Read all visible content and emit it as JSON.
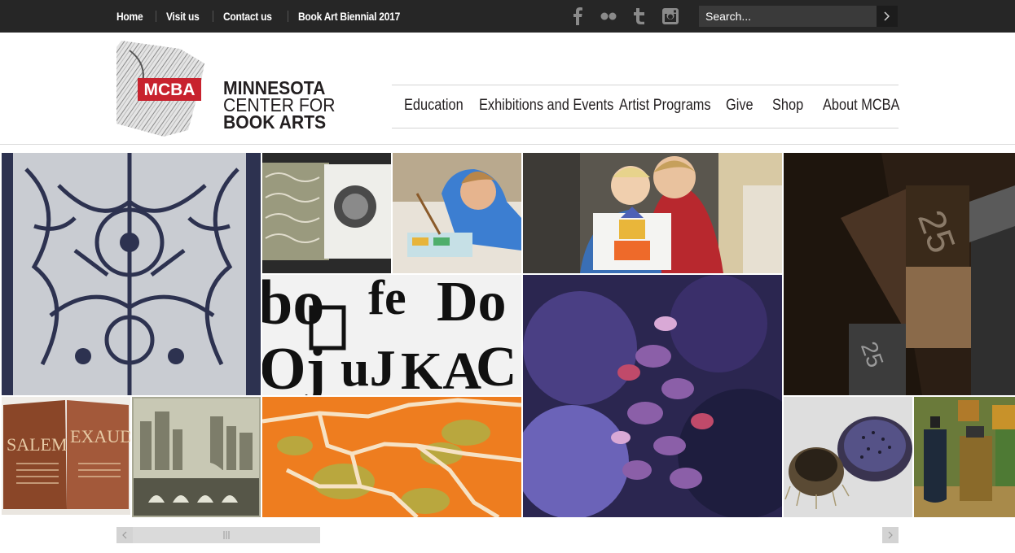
{
  "topbar": {
    "links": [
      "Home",
      "Visit us",
      "Contact us",
      "Book Art Biennial 2017"
    ],
    "social": [
      "facebook-icon",
      "flickr-icon",
      "tumblr-icon",
      "instagram-icon"
    ],
    "search": {
      "placeholder": "Search..."
    }
  },
  "logo": {
    "badge": "MCBA"
  },
  "brand": {
    "line1": "MINNESOTA",
    "line2": "CENTER FOR",
    "line3": "BOOK ARTS"
  },
  "nav": [
    "Education",
    "Exhibitions and Events",
    "Artist Programs",
    "Give",
    "Shop",
    "About MCBA"
  ],
  "gallery": {
    "tiles": [
      {
        "name": "paper-cut-art",
        "colors": [
          "#2d3250",
          "#d8dade"
        ]
      },
      {
        "name": "marbled-book",
        "colors": [
          "#2a2a2a",
          "#e9e7e2"
        ]
      },
      {
        "name": "child-painting",
        "colors": [
          "#f2efe9",
          "#3c7ed1"
        ]
      },
      {
        "name": "child-and-woman",
        "colors": [
          "#4a4a4a",
          "#efe6d8"
        ]
      },
      {
        "name": "letterpress-type",
        "colors": [
          "#2b1e14",
          "#7a5b3c"
        ]
      },
      {
        "name": "letterforms-print",
        "colors": [
          "#f7f7f7",
          "#111111"
        ]
      },
      {
        "name": "purple-collage",
        "colors": [
          "#2b2650",
          "#8b5fa8"
        ]
      },
      {
        "name": "open-book",
        "colors": [
          "#6b3320",
          "#b06b47"
        ]
      },
      {
        "name": "city-bridge-print",
        "colors": [
          "#9b9b86",
          "#565648"
        ]
      },
      {
        "name": "orange-map-print",
        "colors": [
          "#ee7d1f",
          "#b9a73e"
        ]
      },
      {
        "name": "ceramic-bowls",
        "colors": [
          "#dedede",
          "#3a3450"
        ]
      },
      {
        "name": "ink-bottles",
        "colors": [
          "#3a4a2a",
          "#1e2a3a"
        ]
      }
    ]
  },
  "colors": {
    "topbar": "#262626",
    "search_bg": "#3a3a3a",
    "logo_red": "#c8222e",
    "text": "#231f20"
  }
}
